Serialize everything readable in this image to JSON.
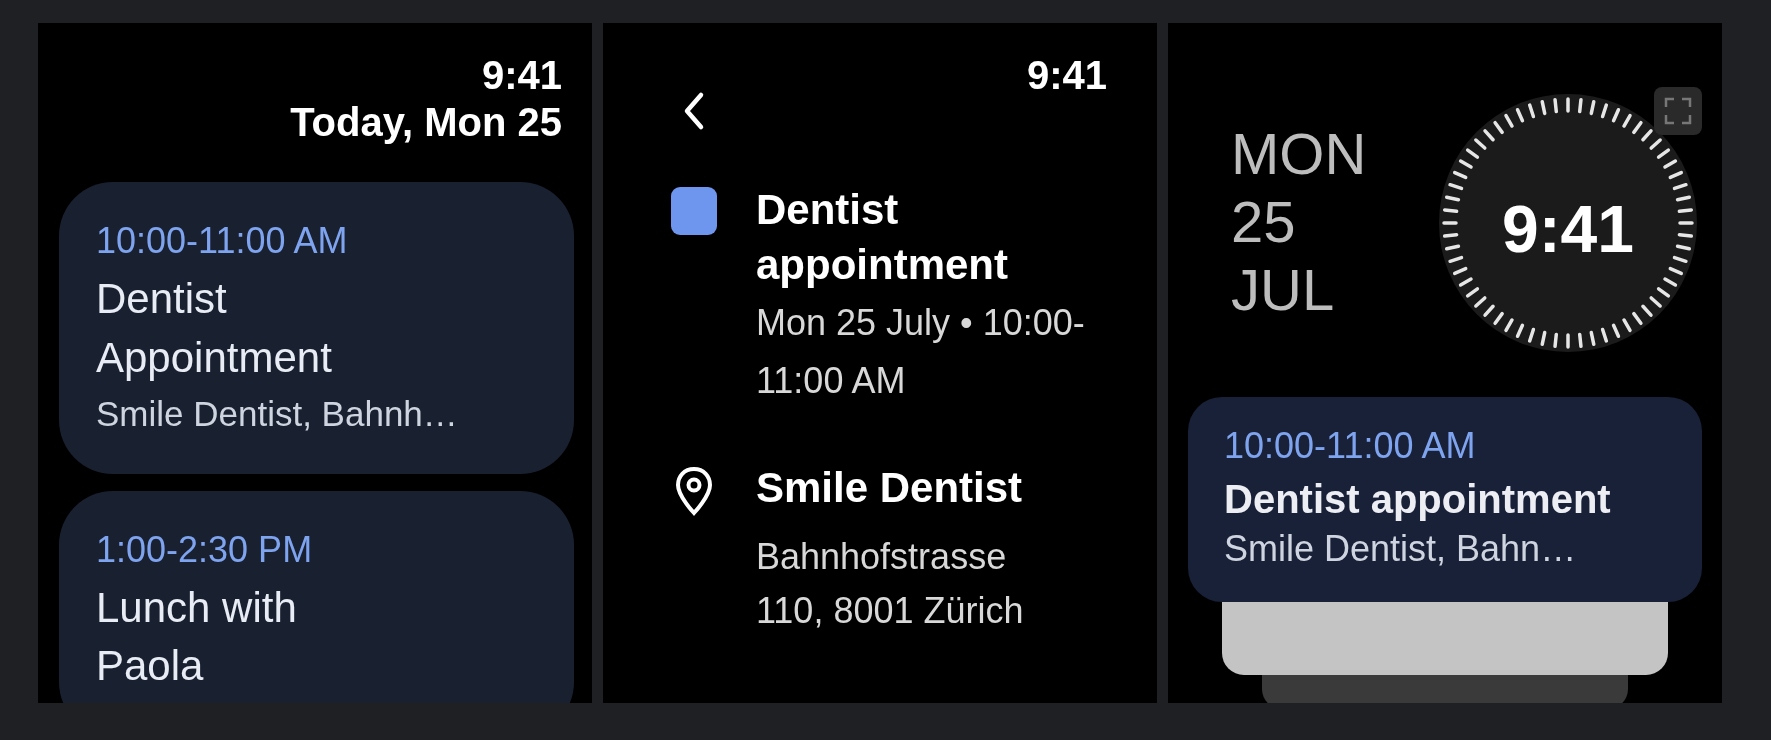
{
  "agenda": {
    "time": "9:41",
    "date": "Today, Mon 25",
    "events": [
      {
        "time": "10:00-11:00 AM",
        "title": "Dentist Appointment",
        "location": "Smile Dentist, Bahnh…"
      },
      {
        "time": "1:00-2:30 PM",
        "title": "Lunch with Paola"
      }
    ]
  },
  "detail": {
    "time": "9:41",
    "event": {
      "color": "#6f96ee",
      "title": "Dentist appointment",
      "when": "Mon 25 July • 10:00-11:00 AM"
    },
    "place": {
      "name": "Smile Dentist",
      "address": "Bahnhofstrasse 110, 8001 Zürich"
    }
  },
  "tile": {
    "weekday": "MON",
    "day": "25",
    "month": "JUL",
    "time": "9:41",
    "event": {
      "time": "10:00-11:00 AM",
      "title": "Dentist appointment",
      "location": "Smile Dentist, Bahn…"
    }
  }
}
